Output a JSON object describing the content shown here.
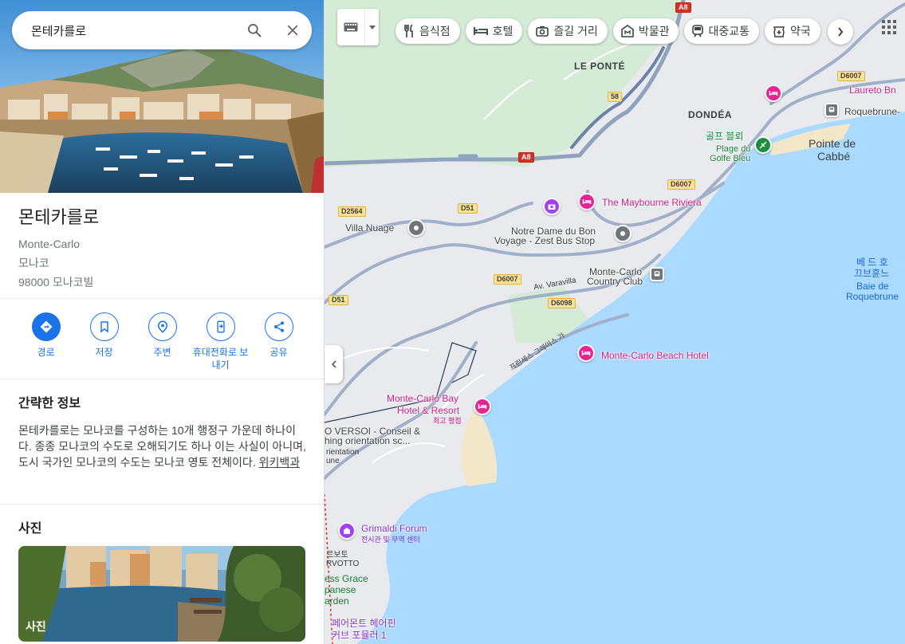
{
  "search": {
    "query": "몬테카를로"
  },
  "place": {
    "title": "몬테카를로",
    "subtitle_en": "Monte-Carlo",
    "country": "모나코",
    "postal": "98000 모나코빌"
  },
  "actions": [
    {
      "label": "경로",
      "icon": "directions-icon"
    },
    {
      "label": "저장",
      "icon": "bookmark-icon"
    },
    {
      "label": "주변",
      "icon": "nearby-icon"
    },
    {
      "label": "휴대전화로 보내기",
      "icon": "send-to-phone-icon"
    },
    {
      "label": "공유",
      "icon": "share-icon"
    }
  ],
  "about": {
    "heading": "간략한 정보",
    "text": "몬테카를로는 모나코를 구성하는 10개 행정구 가운데 하나이다. 종종 모나코의 수도로 오해되기도 하나 이는 사실이 아니며, 도시 국가인 모나코의 수도는 모나코 영토 전체이다.",
    "link": "위키백과"
  },
  "photos": {
    "heading": "사진",
    "caption": "사진"
  },
  "map_toolbar": {
    "chips": [
      {
        "label": "음식점",
        "icon": "restaurant-icon"
      },
      {
        "label": "호텔",
        "icon": "hotel-icon"
      },
      {
        "label": "즐길 거리",
        "icon": "camera-icon"
      },
      {
        "label": "박물관",
        "icon": "museum-icon"
      },
      {
        "label": "대중교통",
        "icon": "transit-icon"
      },
      {
        "label": "약국",
        "icon": "pharmacy-icon"
      }
    ]
  },
  "map_labels": {
    "le_ponte": "LE PONTÉ",
    "dondea": "DONDÉA",
    "laureto": "Laureto Bn",
    "roquebrune": "Roquebrune-",
    "golf_ko": "골프 블뢰",
    "golf_fr1": "Plage du",
    "golf_fr2": "Golfe Bleu",
    "pointe1": "Pointe de",
    "pointe2": "Cabbé",
    "maybourne": "The Maybourne Riviera",
    "villa": "Villa Nuage",
    "notre1": "Notre Dame du Bon",
    "notre2": "Voyage - Zest Bus Stop",
    "mc_club1": "Monte-Carlo",
    "mc_club2": "Country Club",
    "baie_ko1": "베 드 호",
    "baie_ko2": "끄브휸느",
    "baie_fr1": "Baie de",
    "baie_fr2": "Roquebrune",
    "varavilla": "Av. Varavilla",
    "beach_hotel": "Monte-Carlo Beach Hotel",
    "bay_hotel1": "Monte-Carlo Bay",
    "bay_hotel2": "Hotel & Resort",
    "bay_hotel_sub": "최고 평점",
    "versoi1": "O VERSOI - Conseil &",
    "versoi2": "hing orientation sc...",
    "versoi3": "rientation",
    "versoi4": "une",
    "grimaldi": "Grimaldi Forum",
    "grimaldi_sub": "전시관 및 무역 센터",
    "larvotto_ko": "르보토",
    "larvotto": "RVOTTO",
    "grace1": "ess Grace",
    "grace2": "panese",
    "grace3": "arden",
    "fairmont1": "페어몬트 헤어핀",
    "fairmont2": "커브 포뮬러 1",
    "princess_ave": "프린세스 그레이스 가",
    "road_a8_1": "A8",
    "road_a8_2": "A8",
    "road_58": "58",
    "road_d6007_1": "D6007",
    "road_d6007_2": "D6007",
    "road_d6007_3": "D6007",
    "road_d2564": "D2564",
    "road_d51_1": "D51",
    "road_d51_2": "D51",
    "road_d6098": "D6098"
  },
  "colors": {
    "accent": "#1a73e8",
    "water": "#aadaff",
    "land": "#e8eaed",
    "poi_hotel": "#e52592",
    "poi_attraction": "#a142f4"
  }
}
